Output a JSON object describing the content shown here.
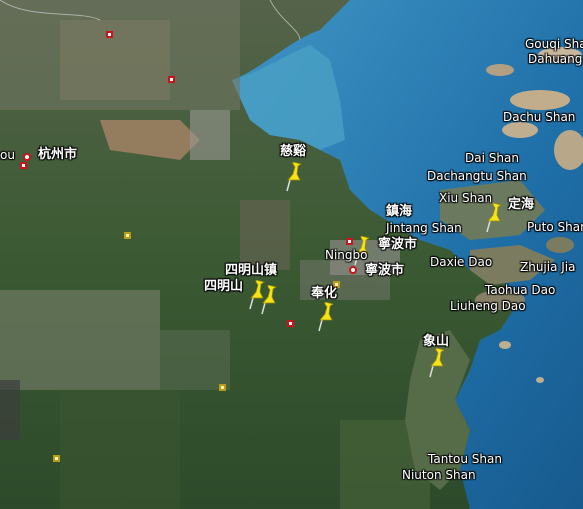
{
  "map": {
    "labels": {
      "hangzhou_partial": "ou",
      "hangzhou": "杭州市",
      "cixi": "慈谿",
      "zhenhai": "鎮海",
      "jintang_shan": "Jintang Shan",
      "ningbo_en": "Ningbo",
      "ningbo_shi_1": "寧波市",
      "ningbo_shi_2": "寧波市",
      "siming_shan_zhen": "四明山镇",
      "siming_shan": "四明山",
      "fenghua": "奉化",
      "daxie_dao": "Daxie Dao",
      "zhujia_jian": "Zhujia Jia",
      "taohua_dao": "Taohua Dao",
      "liuheng_dao": "Liuheng Dao",
      "xiangshan": "象山",
      "tantou_shan": "Tantou Shan",
      "niuton_shan": "Niuton Shan",
      "gouqi_shan": "Gouqi Shan",
      "dahuangdang": "Dahuang",
      "dachu_shan": "Dachu Shan",
      "dai_shan": "Dai Shan",
      "dachangtu_shan": "Dachangtu Shan",
      "xiu_shan": "Xiu Shan",
      "dinghai": "定海",
      "putuo_shan": "Puto Shan"
    },
    "colors": {
      "sea_deep": "#1f6fa8",
      "sea_shallow": "#3f95c4",
      "land_green": "#3b5a33",
      "land_tan": "#8d8a6a",
      "pin_yellow": "#f7e418",
      "city_red": "#c8151b"
    },
    "pins": [
      "cixi-pin",
      "zhenhai-pin",
      "siming-pin-1",
      "siming-pin-2",
      "fenghua-pin",
      "dinghai-pin",
      "xiangshan-pin"
    ]
  }
}
